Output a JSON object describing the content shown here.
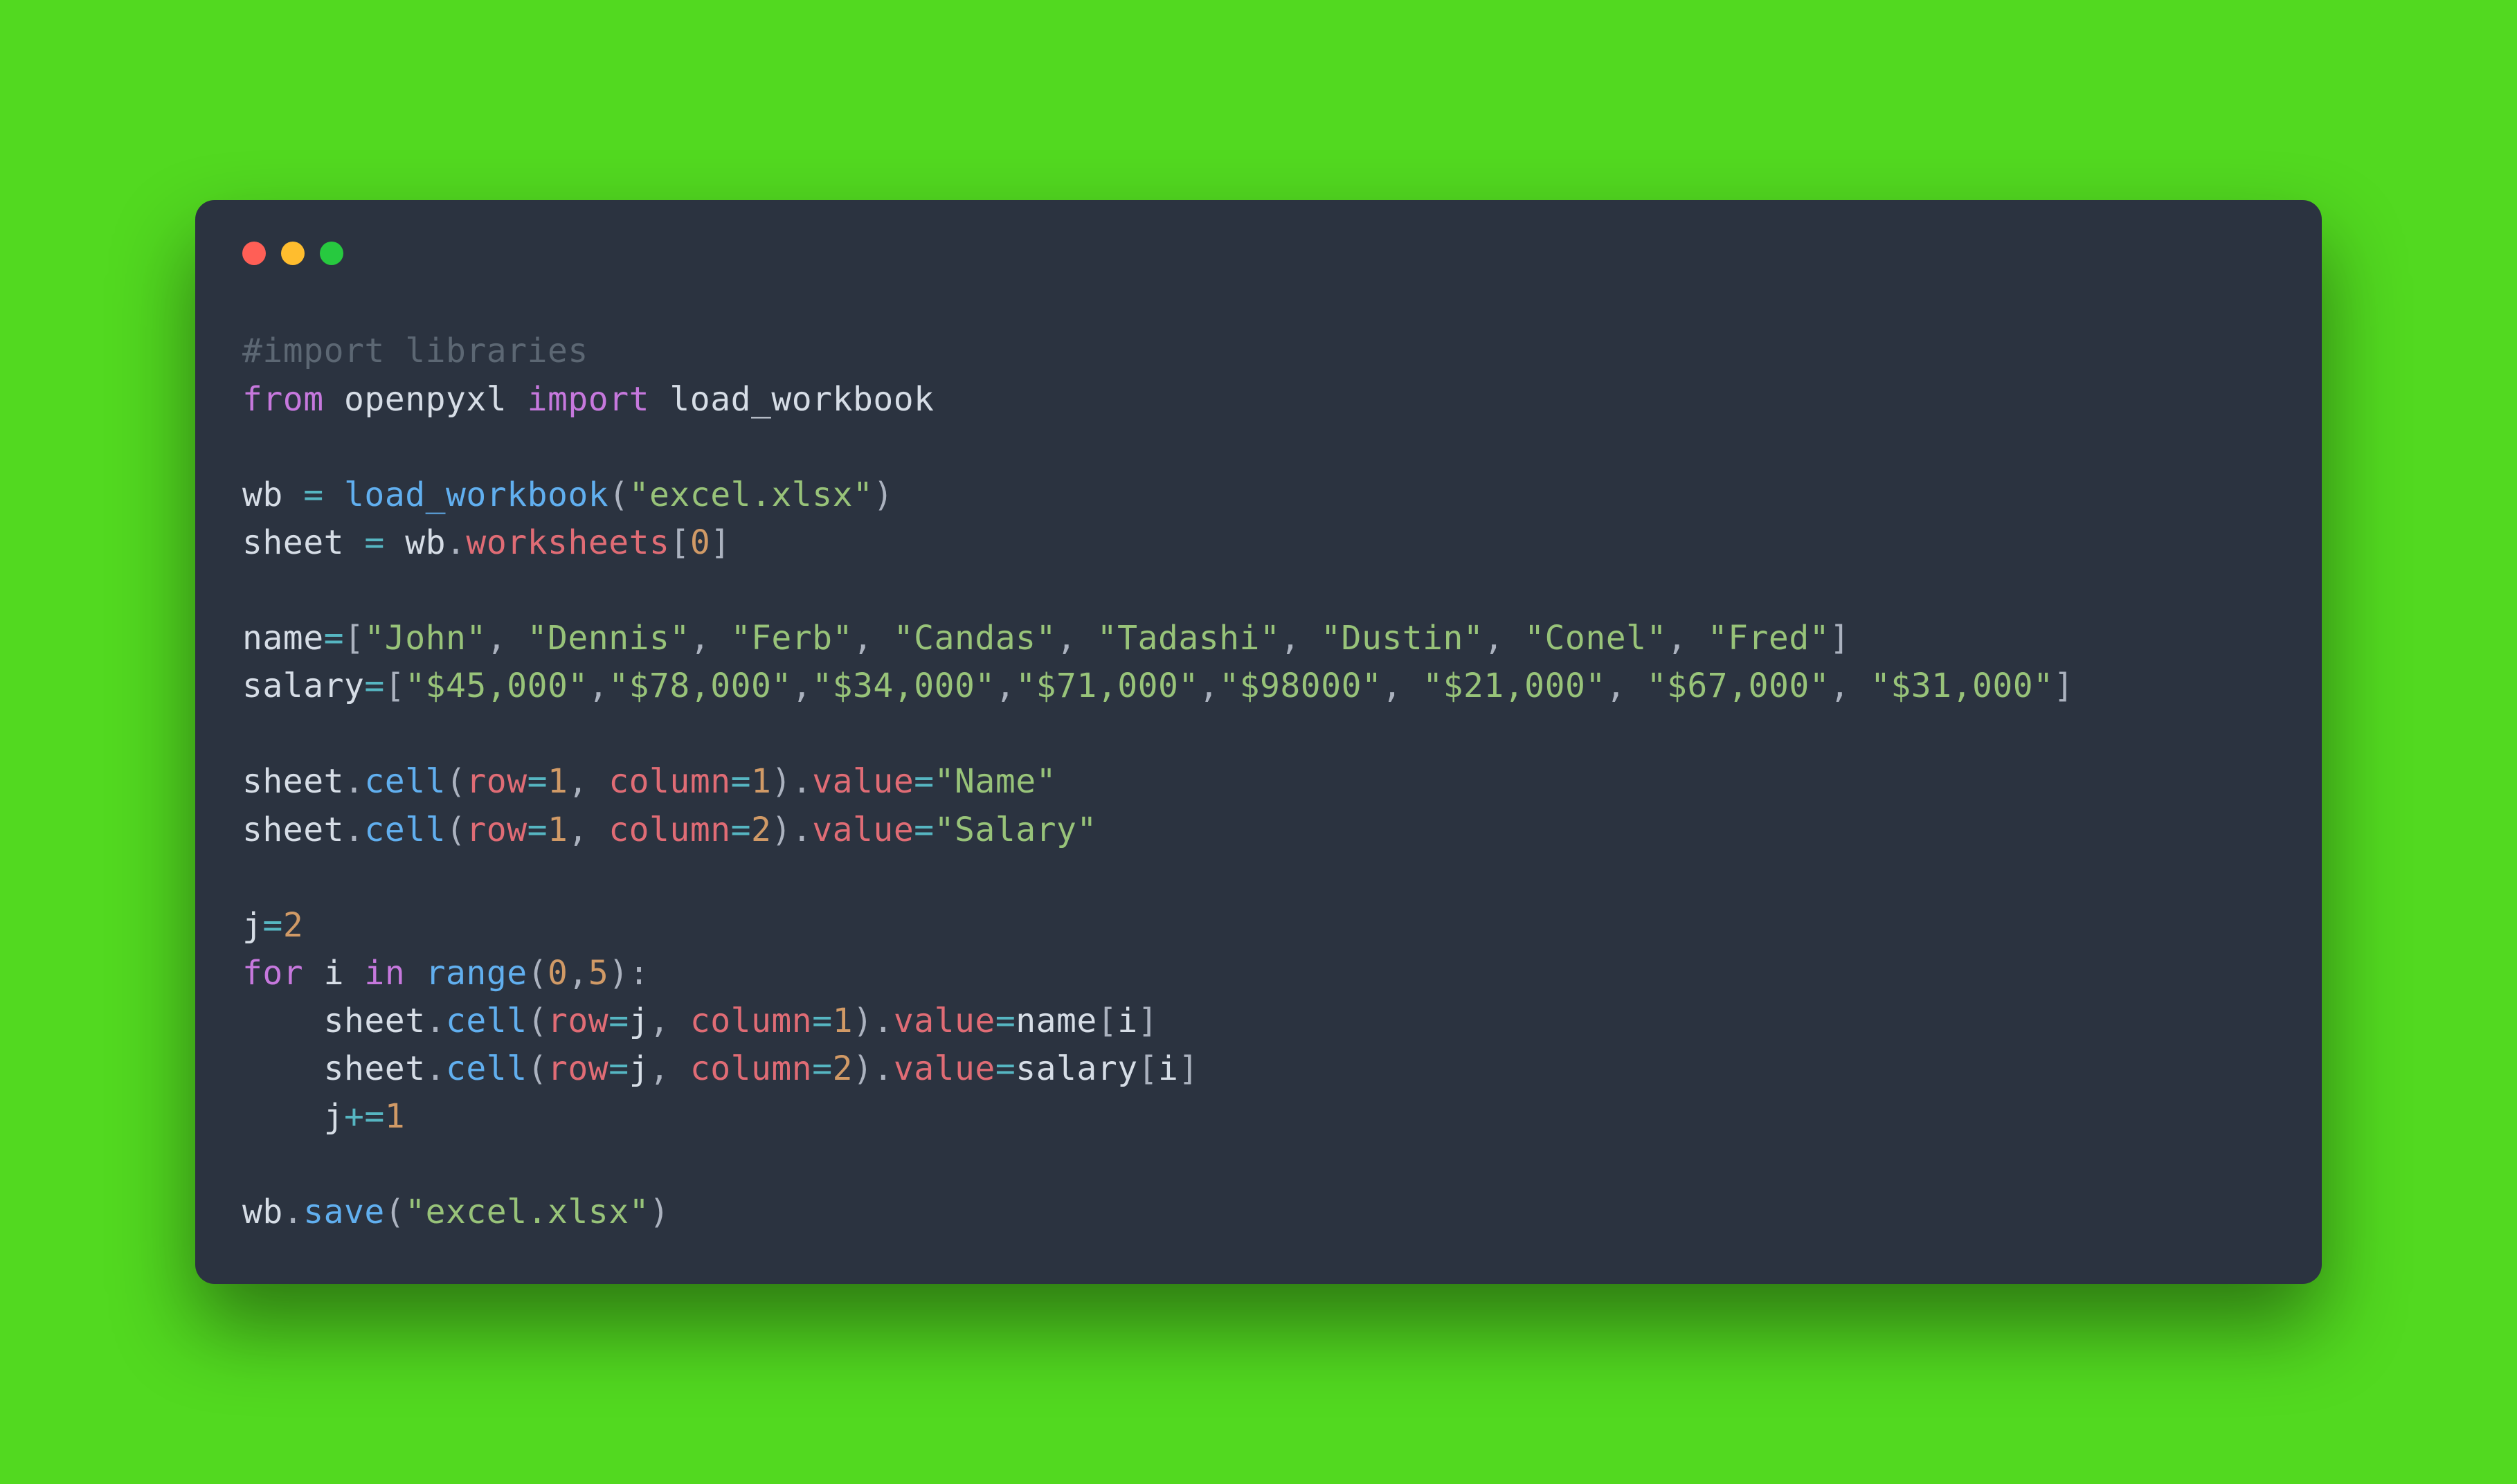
{
  "window": {
    "red": "close-dot",
    "yellow": "minimize-dot",
    "green": "zoom-dot"
  },
  "code": {
    "c1": "#import libraries",
    "kw_from": "from",
    "mod_openpyxl": "openpyxl",
    "kw_import": "import",
    "fn_load_workbook": "load_workbook",
    "var_wb": "wb",
    "eq": "=",
    "str_excel": "\"excel.xlsx\"",
    "var_sheet": "sheet",
    "attr_worksheets": "worksheets",
    "num_0": "0",
    "var_name": "name",
    "names_list": [
      "\"John\"",
      "\"Dennis\"",
      "\"Ferb\"",
      "\"Candas\"",
      "\"Tadashi\"",
      "\"Dustin\"",
      "\"Conel\"",
      "\"Fred\""
    ],
    "var_salary": "salary",
    "salary_list": [
      "\"$45,000\"",
      "\"$78,000\"",
      "\"$34,000\"",
      "\"$71,000\"",
      "\"$98000\"",
      "\"$21,000\"",
      "\"$67,000\"",
      "\"$31,000\""
    ],
    "attr_cell": "cell",
    "attr_row": "row",
    "attr_column": "column",
    "attr_value": "value",
    "num_1": "1",
    "num_2": "2",
    "num_5": "5",
    "str_Name": "\"Name\"",
    "str_Salary": "\"Salary\"",
    "var_j": "j",
    "var_i": "i",
    "kw_for": "for",
    "kw_in": "in",
    "fn_range": "range",
    "attr_save": "save",
    "plus_eq": "+="
  }
}
